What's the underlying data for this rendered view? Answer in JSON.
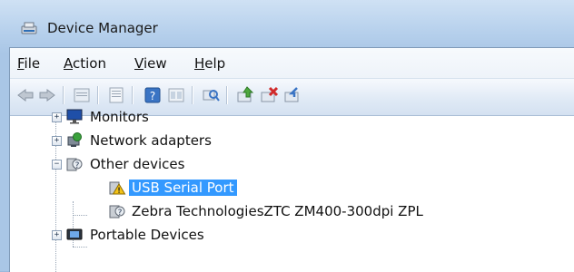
{
  "window": {
    "title": "Device Manager"
  },
  "menu": [
    {
      "label": "File",
      "accel": "F",
      "rest": "ile"
    },
    {
      "label": "Action",
      "accel": "A",
      "rest": "ction"
    },
    {
      "label": "View",
      "accel": "V",
      "rest": "iew"
    },
    {
      "label": "Help",
      "accel": "H",
      "rest": "elp"
    }
  ],
  "toolbar": {
    "buttons": [
      "back-icon",
      "forward-icon",
      "up-icon",
      "properties-icon",
      "help-icon",
      "show-hidden-icon",
      "scan-changes-icon",
      "update-driver-icon",
      "uninstall-icon",
      "disable-icon"
    ]
  },
  "tree": {
    "items": [
      {
        "label": "Monitors",
        "expander": "+",
        "icon": "monitor-icon"
      },
      {
        "label": "Network adapters",
        "expander": "+",
        "icon": "network-adapter-icon"
      },
      {
        "label": "Other devices",
        "expander": "−",
        "icon": "unknown-device-icon"
      },
      {
        "label": "USB Serial Port",
        "icon": "warning-device-icon",
        "selected": true
      },
      {
        "label": "Zebra TechnologiesZTC ZM400-300dpi ZPL",
        "icon": "unknown-device-icon"
      },
      {
        "label": "Portable Devices",
        "expander": "+",
        "icon": "portable-device-icon"
      }
    ]
  },
  "colors": {
    "selection": "#3399ff",
    "accent": "#2f6fb6"
  }
}
